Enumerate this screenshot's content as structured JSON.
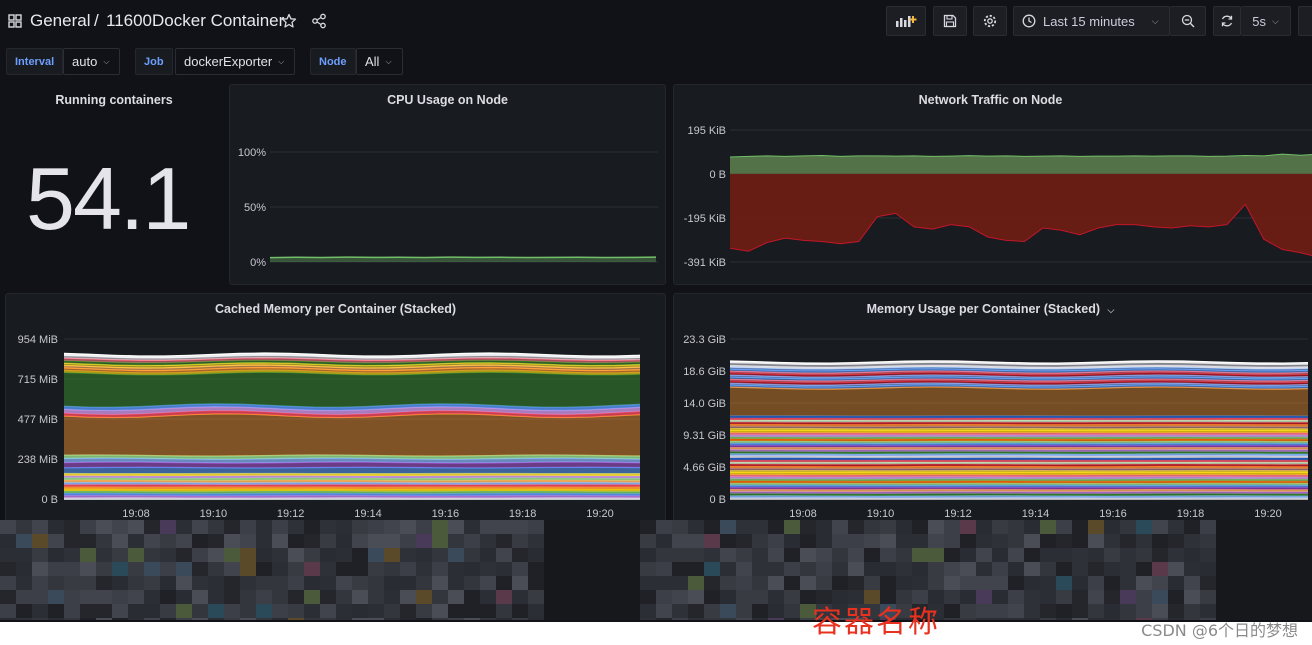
{
  "breadcrumb": {
    "folder": "General",
    "separator": "/",
    "dashboard": "11600Docker Container"
  },
  "toolbar": {
    "icons": [
      "add-panel-icon",
      "save-icon",
      "settings-icon",
      "clock-icon",
      "zoom-out-icon",
      "refresh-icon"
    ],
    "time_range": "Last 15 minutes",
    "refresh_interval": "5s"
  },
  "variables": [
    {
      "label": "Interval",
      "value": "auto"
    },
    {
      "label": "Job",
      "value": "dockerExporter"
    },
    {
      "label": "Node",
      "value": "All"
    }
  ],
  "panels": {
    "running": {
      "title": "Running containers",
      "value": "54.1"
    },
    "cpu": {
      "title": "CPU Usage on Node"
    },
    "network": {
      "title": "Network Traffic on Node"
    },
    "cached": {
      "title": "Cached Memory per Container (Stacked)"
    },
    "memory": {
      "title": "Memory Usage per Container (Stacked)"
    }
  },
  "chart_data": [
    {
      "type": "line",
      "title": "CPU Usage on Node",
      "yticks": [
        "100%",
        "50%",
        "0%"
      ],
      "ylim": [
        0,
        100
      ],
      "series": [
        {
          "values": [
            4,
            4.3,
            4.1,
            4.4,
            4.2,
            4.3,
            4.1,
            4.4,
            4.2,
            4.3,
            4.1,
            4.2,
            4.3,
            4.1,
            4.2,
            4.4
          ]
        }
      ],
      "colors": {
        "line": "#73bf69"
      }
    },
    {
      "type": "area",
      "title": "Network Traffic on Node",
      "yticks": [
        "195 KiB",
        "0 B",
        "-195 KiB",
        "-391 KiB"
      ],
      "ylim": [
        -391,
        195
      ],
      "series": [
        {
          "values": [
            75,
            78,
            80,
            78,
            80,
            82,
            78,
            80,
            80,
            79,
            80,
            78,
            79,
            81,
            79,
            80,
            78,
            79,
            80,
            78,
            79,
            79,
            80,
            79,
            80,
            80,
            78,
            79,
            82,
            80,
            88,
            83,
            88
          ]
        },
        {
          "values": [
            -330,
            -343,
            -305,
            -285,
            -295,
            -300,
            -310,
            -300,
            -190,
            -175,
            -235,
            -245,
            -225,
            -235,
            -280,
            -295,
            -300,
            -240,
            -250,
            -270,
            -240,
            -225,
            -225,
            -235,
            -240,
            -230,
            -235,
            -225,
            -135,
            -290,
            -335,
            -350,
            -370
          ]
        }
      ],
      "colors": {
        "positive": "#56774a",
        "negative": "#6b1d13"
      }
    },
    {
      "type": "area",
      "title": "Cached Memory per Container (Stacked)",
      "x": [
        "19:08",
        "19:10",
        "19:12",
        "19:14",
        "19:16",
        "19:18",
        "19:20"
      ],
      "yticks": [
        "954 MiB",
        "715 MiB",
        "477 MiB",
        "238 MiB",
        "0 B"
      ],
      "ylim": [
        0,
        954
      ]
    },
    {
      "type": "area",
      "title": "Memory Usage per Container (Stacked)",
      "x": [
        "19:08",
        "19:10",
        "19:12",
        "19:14",
        "19:16",
        "19:18",
        "19:20"
      ],
      "yticks": [
        "23.3 GiB",
        "18.6 GiB",
        "14.0 GiB",
        "9.31 GiB",
        "4.66 GiB",
        "0 B"
      ],
      "ylim": [
        0,
        23.3
      ]
    }
  ],
  "annotation": {
    "caption": "容器名称",
    "watermark": "CSDN @6个日的梦想"
  }
}
